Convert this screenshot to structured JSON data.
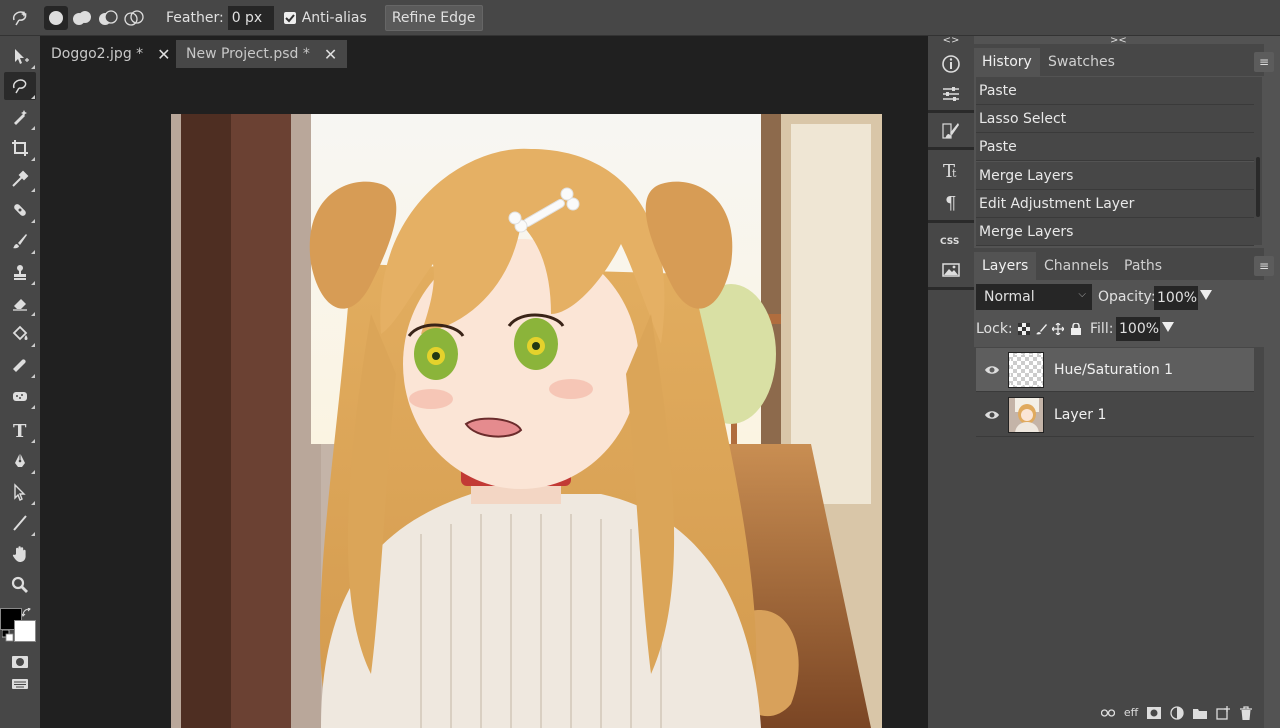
{
  "options": {
    "feather_label": "Feather:",
    "feather_value": "0 px",
    "antialias_label": "Anti-alias",
    "antialias_checked": true,
    "refine_edge_label": "Refine Edge"
  },
  "tabs": [
    {
      "label": "Doggo2.jpg *",
      "active": false
    },
    {
      "label": "New Project.psd *",
      "active": true
    }
  ],
  "icon_column": {
    "collapse_left": "<>",
    "collapse_right": "><"
  },
  "history_panel": {
    "tabs": [
      "History",
      "Swatches"
    ],
    "items": [
      "Paste",
      "Lasso Select",
      "Paste",
      "Merge Layers",
      "Edit Adjustment Layer",
      "Merge Layers"
    ]
  },
  "layers_panel": {
    "tabs": [
      "Layers",
      "Channels",
      "Paths"
    ],
    "blend_mode": "Normal",
    "opacity_label": "Opacity:",
    "opacity_value": "100%",
    "lock_label": "Lock:",
    "fill_label": "Fill:",
    "fill_value": "100%",
    "layers": [
      {
        "name": "Hue/Saturation 1",
        "selected": true
      },
      {
        "name": "Layer 1",
        "selected": false
      }
    ],
    "footer_eff_label": "eff"
  },
  "colors": {
    "foreground": "#000000",
    "background": "#ffffff",
    "ui_dark": "#202020",
    "ui_panel": "#474747"
  }
}
